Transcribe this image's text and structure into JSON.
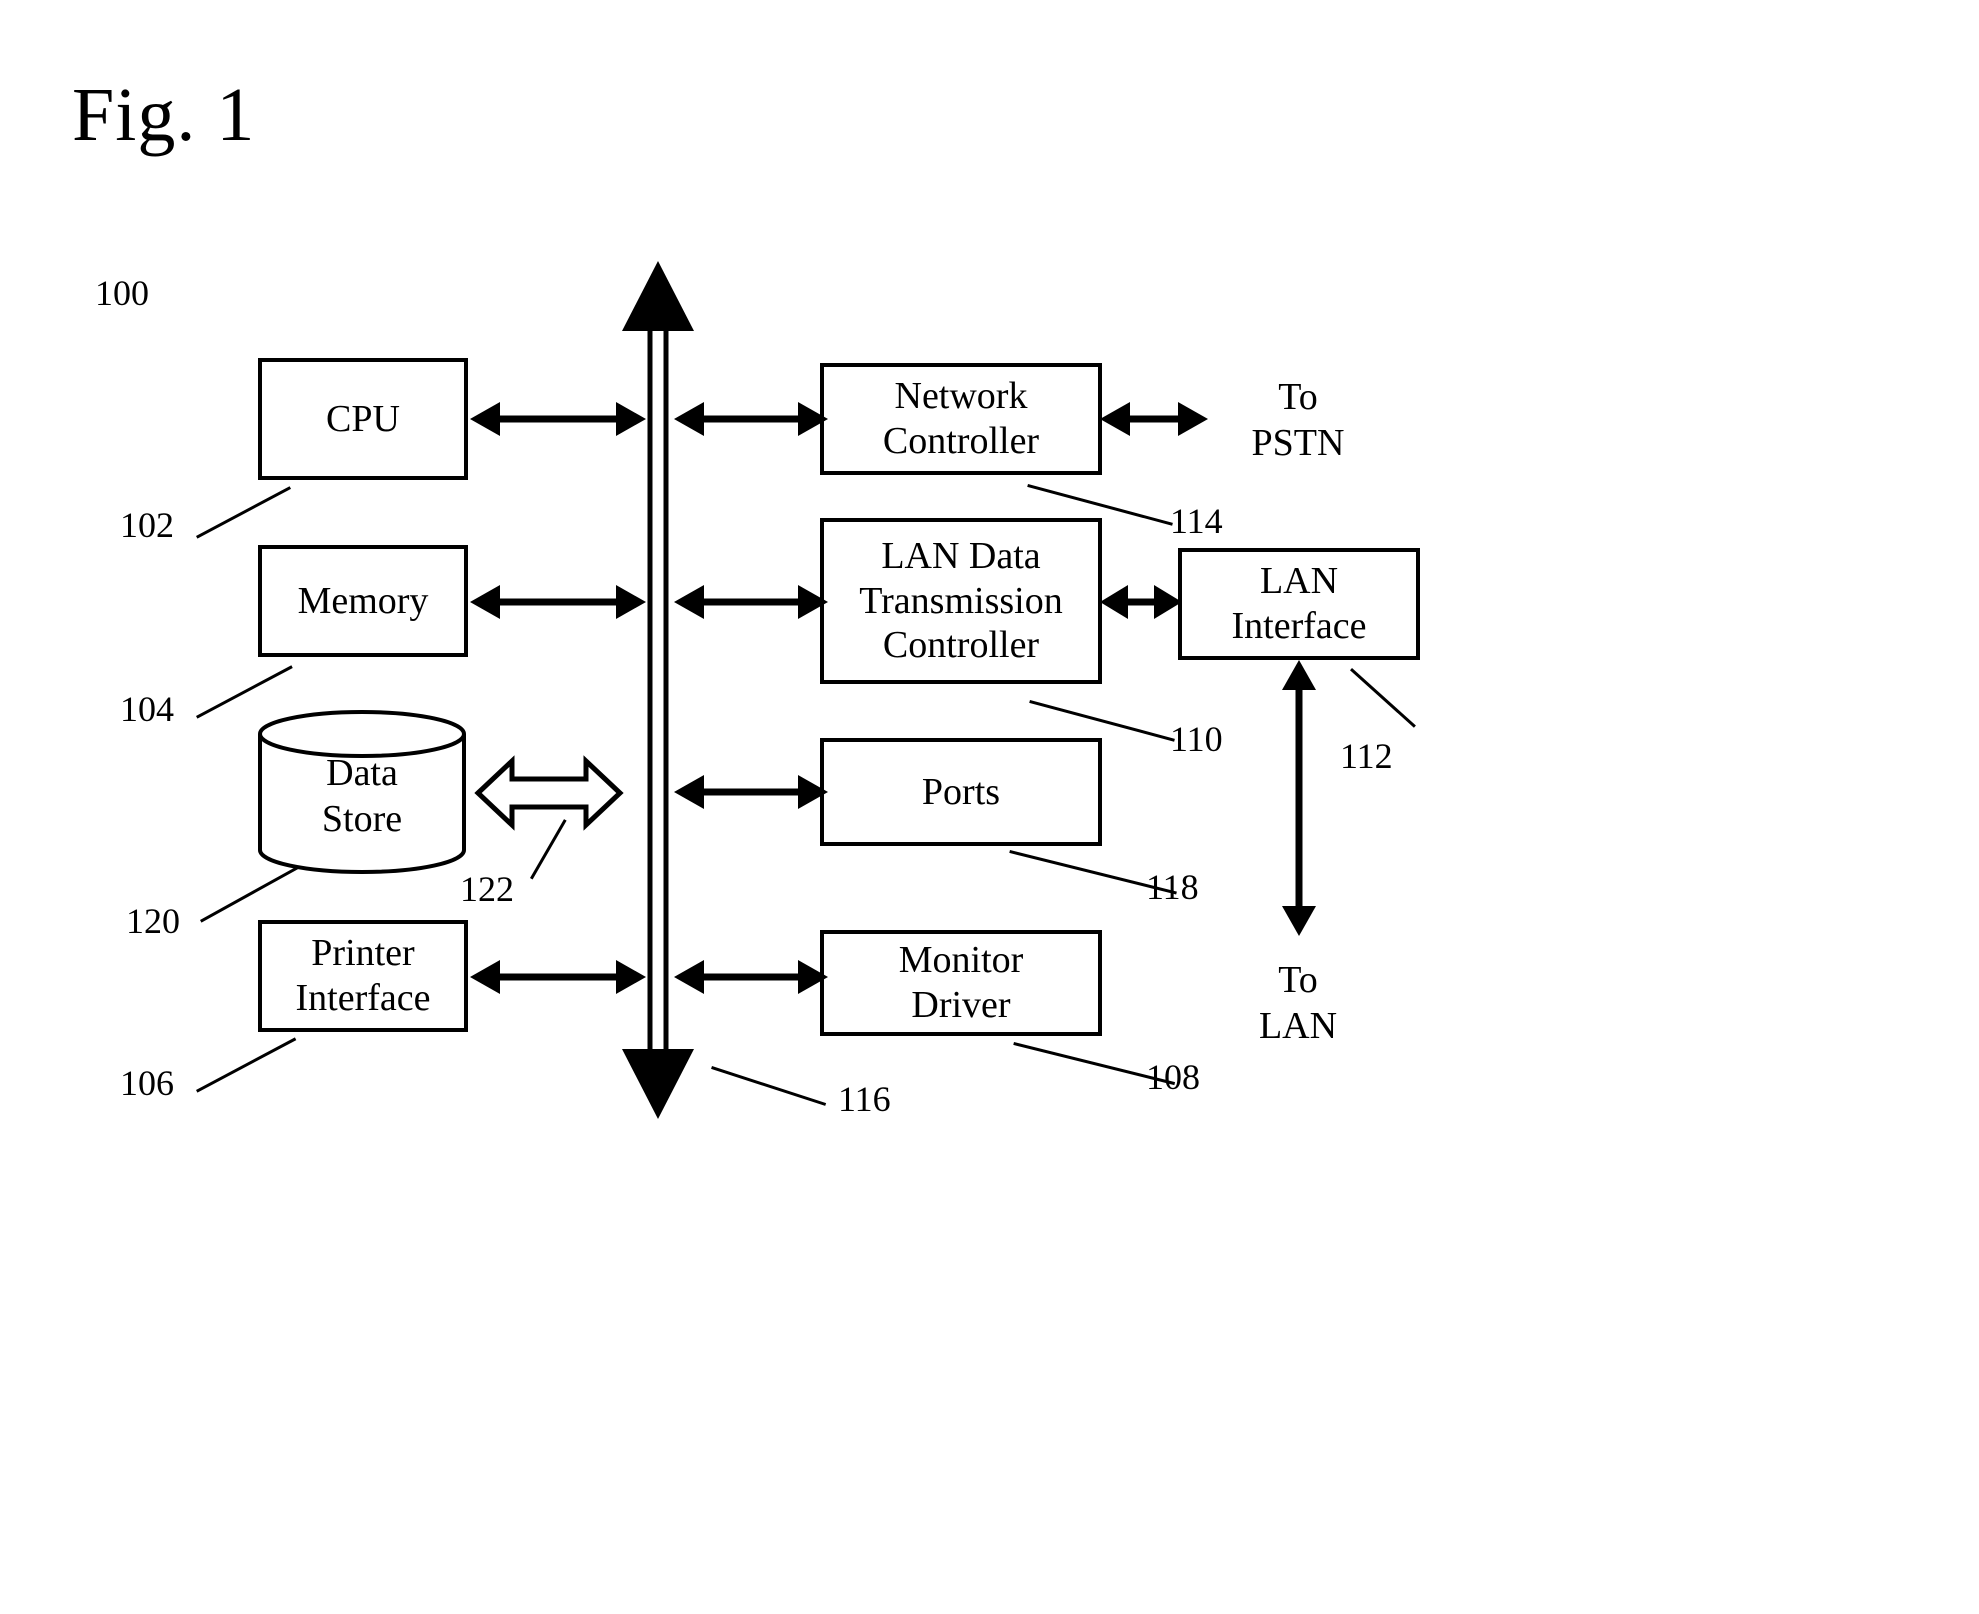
{
  "figure": {
    "title": "Fig. 1",
    "system_ref": "100"
  },
  "blocks": [
    {
      "id": "cpu",
      "label": "CPU",
      "ref": "102"
    },
    {
      "id": "memory",
      "label": "Memory",
      "ref": "104"
    },
    {
      "id": "data-store",
      "label_line1": "Data",
      "label_line2": "Store",
      "ref": "120"
    },
    {
      "id": "printer",
      "label_line1": "Printer",
      "label_line2": "Interface",
      "ref": "106"
    },
    {
      "id": "network-ctrl",
      "label_line1": "Network",
      "label_line2": "Controller",
      "ref": "114"
    },
    {
      "id": "lan-data-ctrl",
      "label_line1": "LAN Data",
      "label_line2": "Transmission",
      "label_line3": "Controller",
      "ref": "110"
    },
    {
      "id": "ports",
      "label": "Ports",
      "ref": "118"
    },
    {
      "id": "monitor-driver",
      "label_line1": "Monitor",
      "label_line2": "Driver",
      "ref": "108"
    },
    {
      "id": "lan-interface",
      "label_line1": "LAN",
      "label_line2": "Interface",
      "ref": "112"
    }
  ],
  "bus": {
    "ref": "116"
  },
  "data_store_link": {
    "ref": "122"
  },
  "external": {
    "pstn_line1": "To",
    "pstn_line2": "PSTN",
    "lan_line1": "To",
    "lan_line2": "LAN"
  },
  "colors": {
    "stroke": "#000000",
    "background": "#ffffff"
  }
}
